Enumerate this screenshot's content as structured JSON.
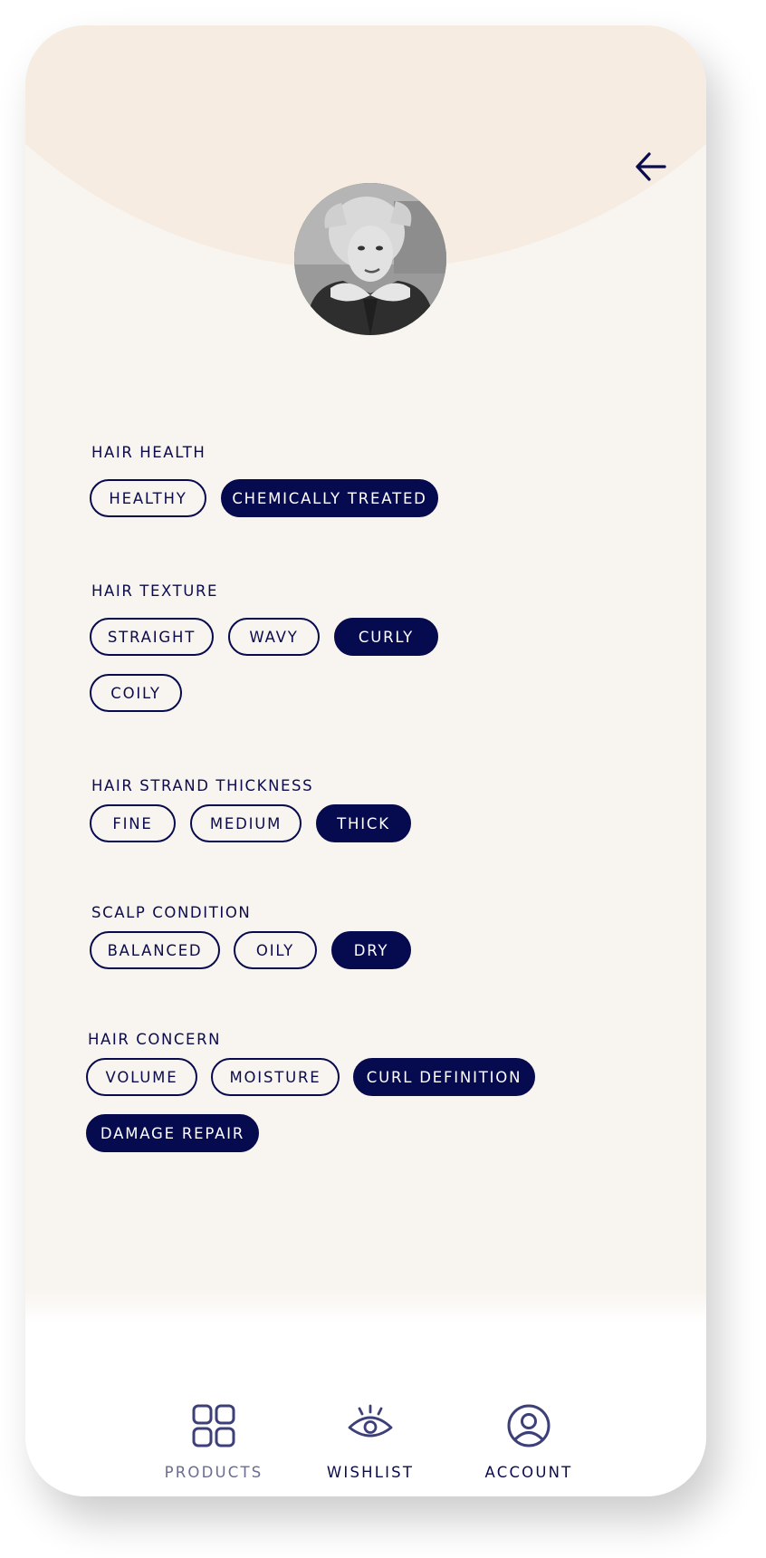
{
  "profile": {
    "avatar_icon": "user-photo"
  },
  "colors": {
    "accent": "#060a4f",
    "background": "#f8f4ef",
    "header_arc": "#f6ece1",
    "muted_nav": "#6a6d91"
  },
  "header": {
    "back_icon": "arrow-left-icon"
  },
  "sections": {
    "hair_health": {
      "label": "HAIR HEALTH",
      "options": [
        {
          "label": "HEALTHY",
          "selected": false
        },
        {
          "label": "CHEMICALLY TREATED",
          "selected": true
        }
      ]
    },
    "hair_texture": {
      "label": "HAIR TEXTURE",
      "options": [
        {
          "label": "STRAIGHT",
          "selected": false
        },
        {
          "label": "WAVY",
          "selected": false
        },
        {
          "label": "CURLY",
          "selected": true
        },
        {
          "label": "COILY",
          "selected": false
        }
      ]
    },
    "strand_thickness": {
      "label": "HAIR STRAND THICKNESS",
      "options": [
        {
          "label": "FINE",
          "selected": false
        },
        {
          "label": "MEDIUM",
          "selected": false
        },
        {
          "label": "THICK",
          "selected": true
        }
      ]
    },
    "scalp_condition": {
      "label": "SCALP CONDITION",
      "options": [
        {
          "label": "BALANCED",
          "selected": false
        },
        {
          "label": "OILY",
          "selected": false
        },
        {
          "label": "DRY",
          "selected": true
        }
      ]
    },
    "hair_concern": {
      "label": "HAIR CONCERN",
      "options": [
        {
          "label": "VOLUME",
          "selected": false
        },
        {
          "label": "MOISTURE",
          "selected": false
        },
        {
          "label": "CURL DEFINITION",
          "selected": true
        },
        {
          "label": "DAMAGE REPAIR",
          "selected": true
        }
      ]
    }
  },
  "nav": {
    "items": [
      {
        "label": "PRODUCTS",
        "icon": "grid-icon",
        "active": false
      },
      {
        "label": "WISHLIST",
        "icon": "eye-icon",
        "active": true
      },
      {
        "label": "ACCOUNT",
        "icon": "user-circle-icon",
        "active": true
      }
    ]
  }
}
